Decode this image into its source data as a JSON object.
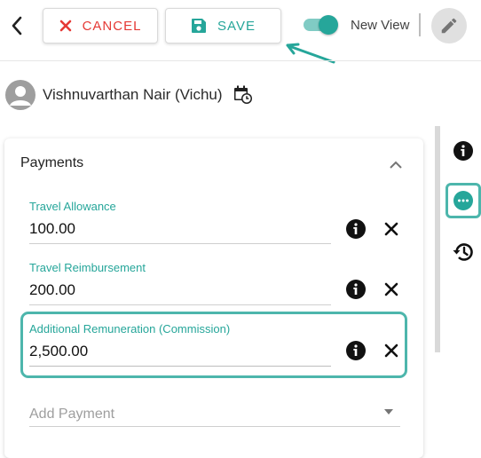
{
  "toolbar": {
    "cancel_label": "CANCEL",
    "save_label": "SAVE",
    "view_toggle": {
      "label": "New View",
      "on": true
    }
  },
  "person": {
    "name": "Vishnuvarthan Nair (Vichu)"
  },
  "payments": {
    "title": "Payments",
    "fields": [
      {
        "label": "Travel Allowance",
        "value": "100.00"
      },
      {
        "label": "Travel Reimbursement",
        "value": "200.00"
      },
      {
        "label": "Additional Remuneration (Commission)",
        "value": "2,500.00"
      }
    ],
    "add_placeholder": "Add Payment"
  },
  "icons": {
    "back": "chevron-left-icon",
    "cancel": "close-icon",
    "save": "floppy-disk-icon",
    "edit": "pencil-icon",
    "avatar": "account-circle-icon",
    "calendar": "calendar-clock-icon",
    "info": "info-icon",
    "remove": "close-icon",
    "more": "more-horizontal-icon",
    "history": "history-icon"
  },
  "colors": {
    "accent": "#26a69a",
    "danger": "#e53935",
    "highlight": "#4db6ac"
  }
}
